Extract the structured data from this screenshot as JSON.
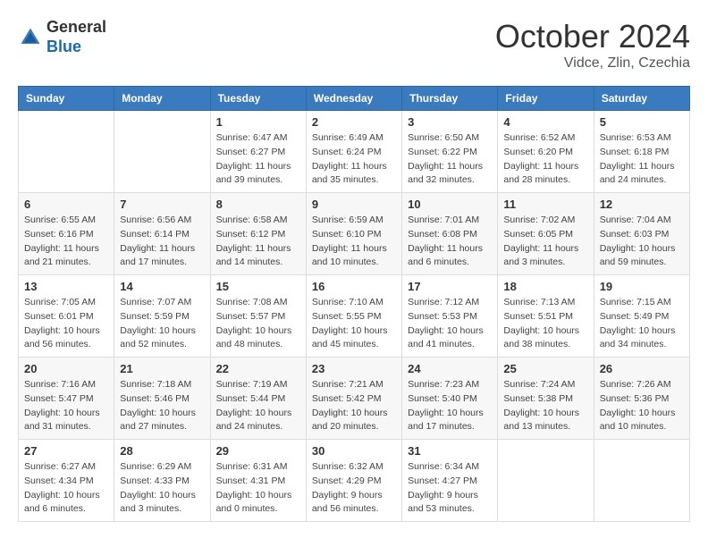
{
  "header": {
    "logo_general": "General",
    "logo_blue": "Blue",
    "month": "October 2024",
    "location": "Vidce, Zlin, Czechia"
  },
  "days_of_week": [
    "Sunday",
    "Monday",
    "Tuesday",
    "Wednesday",
    "Thursday",
    "Friday",
    "Saturday"
  ],
  "weeks": [
    [
      {
        "day": "",
        "sunrise": "",
        "sunset": "",
        "daylight": ""
      },
      {
        "day": "",
        "sunrise": "",
        "sunset": "",
        "daylight": ""
      },
      {
        "day": "1",
        "sunrise": "Sunrise: 6:47 AM",
        "sunset": "Sunset: 6:27 PM",
        "daylight": "Daylight: 11 hours and 39 minutes."
      },
      {
        "day": "2",
        "sunrise": "Sunrise: 6:49 AM",
        "sunset": "Sunset: 6:24 PM",
        "daylight": "Daylight: 11 hours and 35 minutes."
      },
      {
        "day": "3",
        "sunrise": "Sunrise: 6:50 AM",
        "sunset": "Sunset: 6:22 PM",
        "daylight": "Daylight: 11 hours and 32 minutes."
      },
      {
        "day": "4",
        "sunrise": "Sunrise: 6:52 AM",
        "sunset": "Sunset: 6:20 PM",
        "daylight": "Daylight: 11 hours and 28 minutes."
      },
      {
        "day": "5",
        "sunrise": "Sunrise: 6:53 AM",
        "sunset": "Sunset: 6:18 PM",
        "daylight": "Daylight: 11 hours and 24 minutes."
      }
    ],
    [
      {
        "day": "6",
        "sunrise": "Sunrise: 6:55 AM",
        "sunset": "Sunset: 6:16 PM",
        "daylight": "Daylight: 11 hours and 21 minutes."
      },
      {
        "day": "7",
        "sunrise": "Sunrise: 6:56 AM",
        "sunset": "Sunset: 6:14 PM",
        "daylight": "Daylight: 11 hours and 17 minutes."
      },
      {
        "day": "8",
        "sunrise": "Sunrise: 6:58 AM",
        "sunset": "Sunset: 6:12 PM",
        "daylight": "Daylight: 11 hours and 14 minutes."
      },
      {
        "day": "9",
        "sunrise": "Sunrise: 6:59 AM",
        "sunset": "Sunset: 6:10 PM",
        "daylight": "Daylight: 11 hours and 10 minutes."
      },
      {
        "day": "10",
        "sunrise": "Sunrise: 7:01 AM",
        "sunset": "Sunset: 6:08 PM",
        "daylight": "Daylight: 11 hours and 6 minutes."
      },
      {
        "day": "11",
        "sunrise": "Sunrise: 7:02 AM",
        "sunset": "Sunset: 6:05 PM",
        "daylight": "Daylight: 11 hours and 3 minutes."
      },
      {
        "day": "12",
        "sunrise": "Sunrise: 7:04 AM",
        "sunset": "Sunset: 6:03 PM",
        "daylight": "Daylight: 10 hours and 59 minutes."
      }
    ],
    [
      {
        "day": "13",
        "sunrise": "Sunrise: 7:05 AM",
        "sunset": "Sunset: 6:01 PM",
        "daylight": "Daylight: 10 hours and 56 minutes."
      },
      {
        "day": "14",
        "sunrise": "Sunrise: 7:07 AM",
        "sunset": "Sunset: 5:59 PM",
        "daylight": "Daylight: 10 hours and 52 minutes."
      },
      {
        "day": "15",
        "sunrise": "Sunrise: 7:08 AM",
        "sunset": "Sunset: 5:57 PM",
        "daylight": "Daylight: 10 hours and 48 minutes."
      },
      {
        "day": "16",
        "sunrise": "Sunrise: 7:10 AM",
        "sunset": "Sunset: 5:55 PM",
        "daylight": "Daylight: 10 hours and 45 minutes."
      },
      {
        "day": "17",
        "sunrise": "Sunrise: 7:12 AM",
        "sunset": "Sunset: 5:53 PM",
        "daylight": "Daylight: 10 hours and 41 minutes."
      },
      {
        "day": "18",
        "sunrise": "Sunrise: 7:13 AM",
        "sunset": "Sunset: 5:51 PM",
        "daylight": "Daylight: 10 hours and 38 minutes."
      },
      {
        "day": "19",
        "sunrise": "Sunrise: 7:15 AM",
        "sunset": "Sunset: 5:49 PM",
        "daylight": "Daylight: 10 hours and 34 minutes."
      }
    ],
    [
      {
        "day": "20",
        "sunrise": "Sunrise: 7:16 AM",
        "sunset": "Sunset: 5:47 PM",
        "daylight": "Daylight: 10 hours and 31 minutes."
      },
      {
        "day": "21",
        "sunrise": "Sunrise: 7:18 AM",
        "sunset": "Sunset: 5:46 PM",
        "daylight": "Daylight: 10 hours and 27 minutes."
      },
      {
        "day": "22",
        "sunrise": "Sunrise: 7:19 AM",
        "sunset": "Sunset: 5:44 PM",
        "daylight": "Daylight: 10 hours and 24 minutes."
      },
      {
        "day": "23",
        "sunrise": "Sunrise: 7:21 AM",
        "sunset": "Sunset: 5:42 PM",
        "daylight": "Daylight: 10 hours and 20 minutes."
      },
      {
        "day": "24",
        "sunrise": "Sunrise: 7:23 AM",
        "sunset": "Sunset: 5:40 PM",
        "daylight": "Daylight: 10 hours and 17 minutes."
      },
      {
        "day": "25",
        "sunrise": "Sunrise: 7:24 AM",
        "sunset": "Sunset: 5:38 PM",
        "daylight": "Daylight: 10 hours and 13 minutes."
      },
      {
        "day": "26",
        "sunrise": "Sunrise: 7:26 AM",
        "sunset": "Sunset: 5:36 PM",
        "daylight": "Daylight: 10 hours and 10 minutes."
      }
    ],
    [
      {
        "day": "27",
        "sunrise": "Sunrise: 6:27 AM",
        "sunset": "Sunset: 4:34 PM",
        "daylight": "Daylight: 10 hours and 6 minutes."
      },
      {
        "day": "28",
        "sunrise": "Sunrise: 6:29 AM",
        "sunset": "Sunset: 4:33 PM",
        "daylight": "Daylight: 10 hours and 3 minutes."
      },
      {
        "day": "29",
        "sunrise": "Sunrise: 6:31 AM",
        "sunset": "Sunset: 4:31 PM",
        "daylight": "Daylight: 10 hours and 0 minutes."
      },
      {
        "day": "30",
        "sunrise": "Sunrise: 6:32 AM",
        "sunset": "Sunset: 4:29 PM",
        "daylight": "Daylight: 9 hours and 56 minutes."
      },
      {
        "day": "31",
        "sunrise": "Sunrise: 6:34 AM",
        "sunset": "Sunset: 4:27 PM",
        "daylight": "Daylight: 9 hours and 53 minutes."
      },
      {
        "day": "",
        "sunrise": "",
        "sunset": "",
        "daylight": ""
      },
      {
        "day": "",
        "sunrise": "",
        "sunset": "",
        "daylight": ""
      }
    ]
  ]
}
